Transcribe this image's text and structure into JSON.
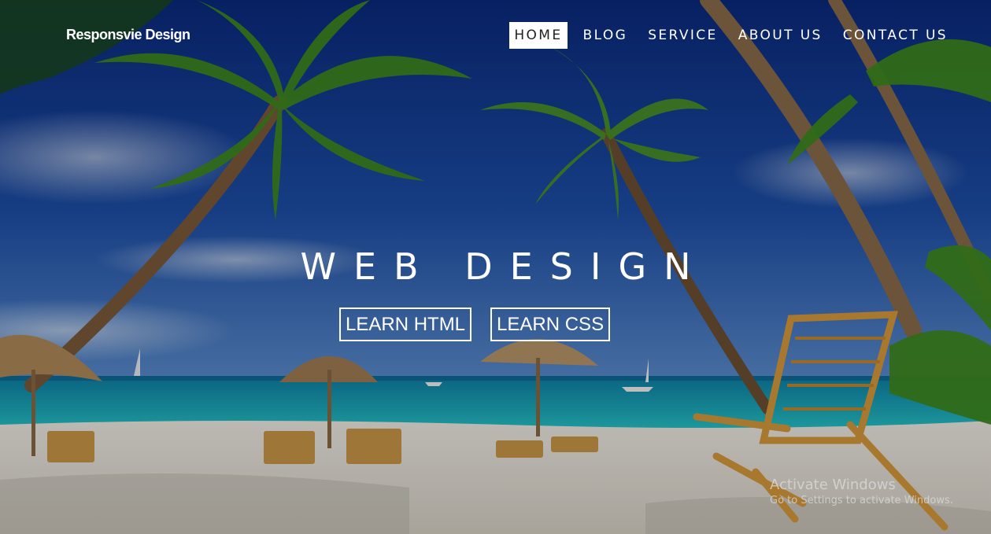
{
  "header": {
    "logo_text": "Responsvie Design",
    "nav": [
      {
        "label": "HOME",
        "active": true
      },
      {
        "label": "BLOG",
        "active": false
      },
      {
        "label": "SERVICE",
        "active": false
      },
      {
        "label": "ABOUT US",
        "active": false
      },
      {
        "label": "CONTACT US",
        "active": false
      }
    ]
  },
  "hero": {
    "title": "WEB DESIGN",
    "buttons": [
      {
        "label": "LEARN HTML"
      },
      {
        "label": "LEARN CSS"
      }
    ],
    "background_description_icon": "beach-palm-trees-image"
  },
  "watermark": {
    "title": "Activate Windows",
    "subtitle": "Go to Settings to activate Windows."
  },
  "colors": {
    "sky_top": "#0b2f8a",
    "sky_bottom": "#2f6fc0",
    "sea": "#1bb5c4",
    "sand": "#e9e4dc",
    "palm_leaf": "#3f8a1f",
    "active_nav_bg": "#ffffff",
    "text": "#ffffff"
  }
}
